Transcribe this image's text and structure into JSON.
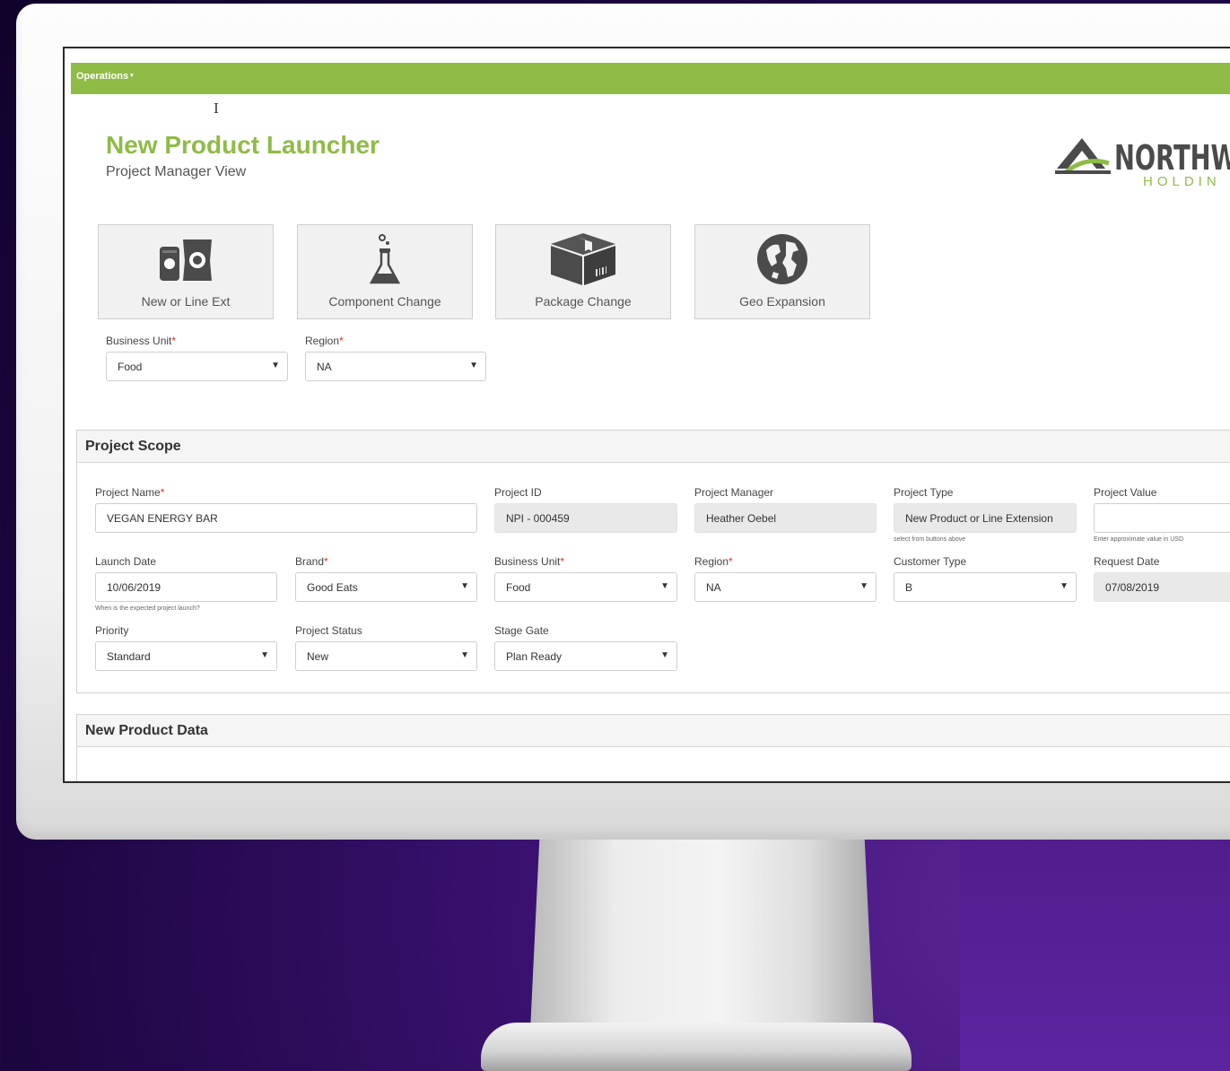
{
  "topbar": {
    "menu_label": "Operations",
    "menu_caret": "▾"
  },
  "header": {
    "title": "New Product Launcher",
    "subtitle": "Project Manager View",
    "logo_text": "NORTHW",
    "logo_subtext": "HOLDIN"
  },
  "tiles": [
    {
      "label": "New or Line Ext",
      "icon": "snacks-icon"
    },
    {
      "label": "Component Change",
      "icon": "flask-icon"
    },
    {
      "label": "Package Change",
      "icon": "box-icon"
    },
    {
      "label": "Geo Expansion",
      "icon": "globe-icon"
    }
  ],
  "filters": {
    "business_unit": {
      "label": "Business Unit",
      "value": "Food"
    },
    "region": {
      "label": "Region",
      "value": "NA"
    }
  },
  "required_mark": "*",
  "select_arrow": "▼",
  "project_scope": {
    "title": "Project Scope",
    "project_name": {
      "label": "Project Name",
      "value": "VEGAN ENERGY BAR"
    },
    "project_id": {
      "label": "Project ID",
      "value": "NPI - 000459"
    },
    "project_manager": {
      "label": "Project Manager",
      "value": "Heather Oebel"
    },
    "project_type": {
      "label": "Project Type",
      "value": "New Product or Line Extension",
      "hint": "select from buttons above"
    },
    "project_value": {
      "label": "Project Value",
      "value": "",
      "hint": "Enter approximate value in USD"
    },
    "launch_date": {
      "label": "Launch Date",
      "value": "10/06/2019",
      "hint": "When is the expected project launch?"
    },
    "brand": {
      "label": "Brand",
      "value": "Good Eats"
    },
    "business_unit": {
      "label": "Business Unit",
      "value": "Food"
    },
    "region": {
      "label": "Region",
      "value": "NA"
    },
    "customer_type": {
      "label": "Customer Type",
      "value": "B"
    },
    "request_date": {
      "label": "Request Date",
      "value": "07/08/2019"
    },
    "priority": {
      "label": "Priority",
      "value": "Standard"
    },
    "project_status": {
      "label": "Project Status",
      "value": "New"
    },
    "stage_gate": {
      "label": "Stage Gate",
      "value": "Plan Ready"
    }
  },
  "new_product_data": {
    "title": "New Product Data"
  },
  "colors": {
    "accent": "#8fbb47",
    "required": "#d9342b",
    "tile_bg": "#f1f1f1"
  }
}
